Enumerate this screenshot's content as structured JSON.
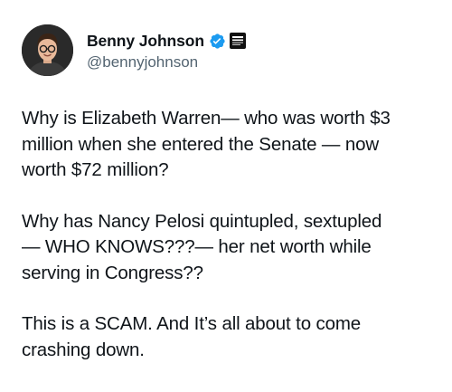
{
  "author": {
    "display_name": "Benny Johnson",
    "handle": "@bennyjohnson",
    "verified_icon": "verified-badge-icon",
    "affiliate_icon": "affiliate-badge-icon",
    "accent_color": "#1d9bf0"
  },
  "tweet": {
    "paragraphs": [
      "Why is Elizabeth Warren— who was worth $3\nmillion when she entered the Senate — now\nworth $72 million?",
      "Why has Nancy Pelosi quintupled, sextupled\n— WHO KNOWS???— her net worth while\nserving in Congress??",
      "This is a SCAM. And It’s all about to come\ncrashing down."
    ]
  }
}
